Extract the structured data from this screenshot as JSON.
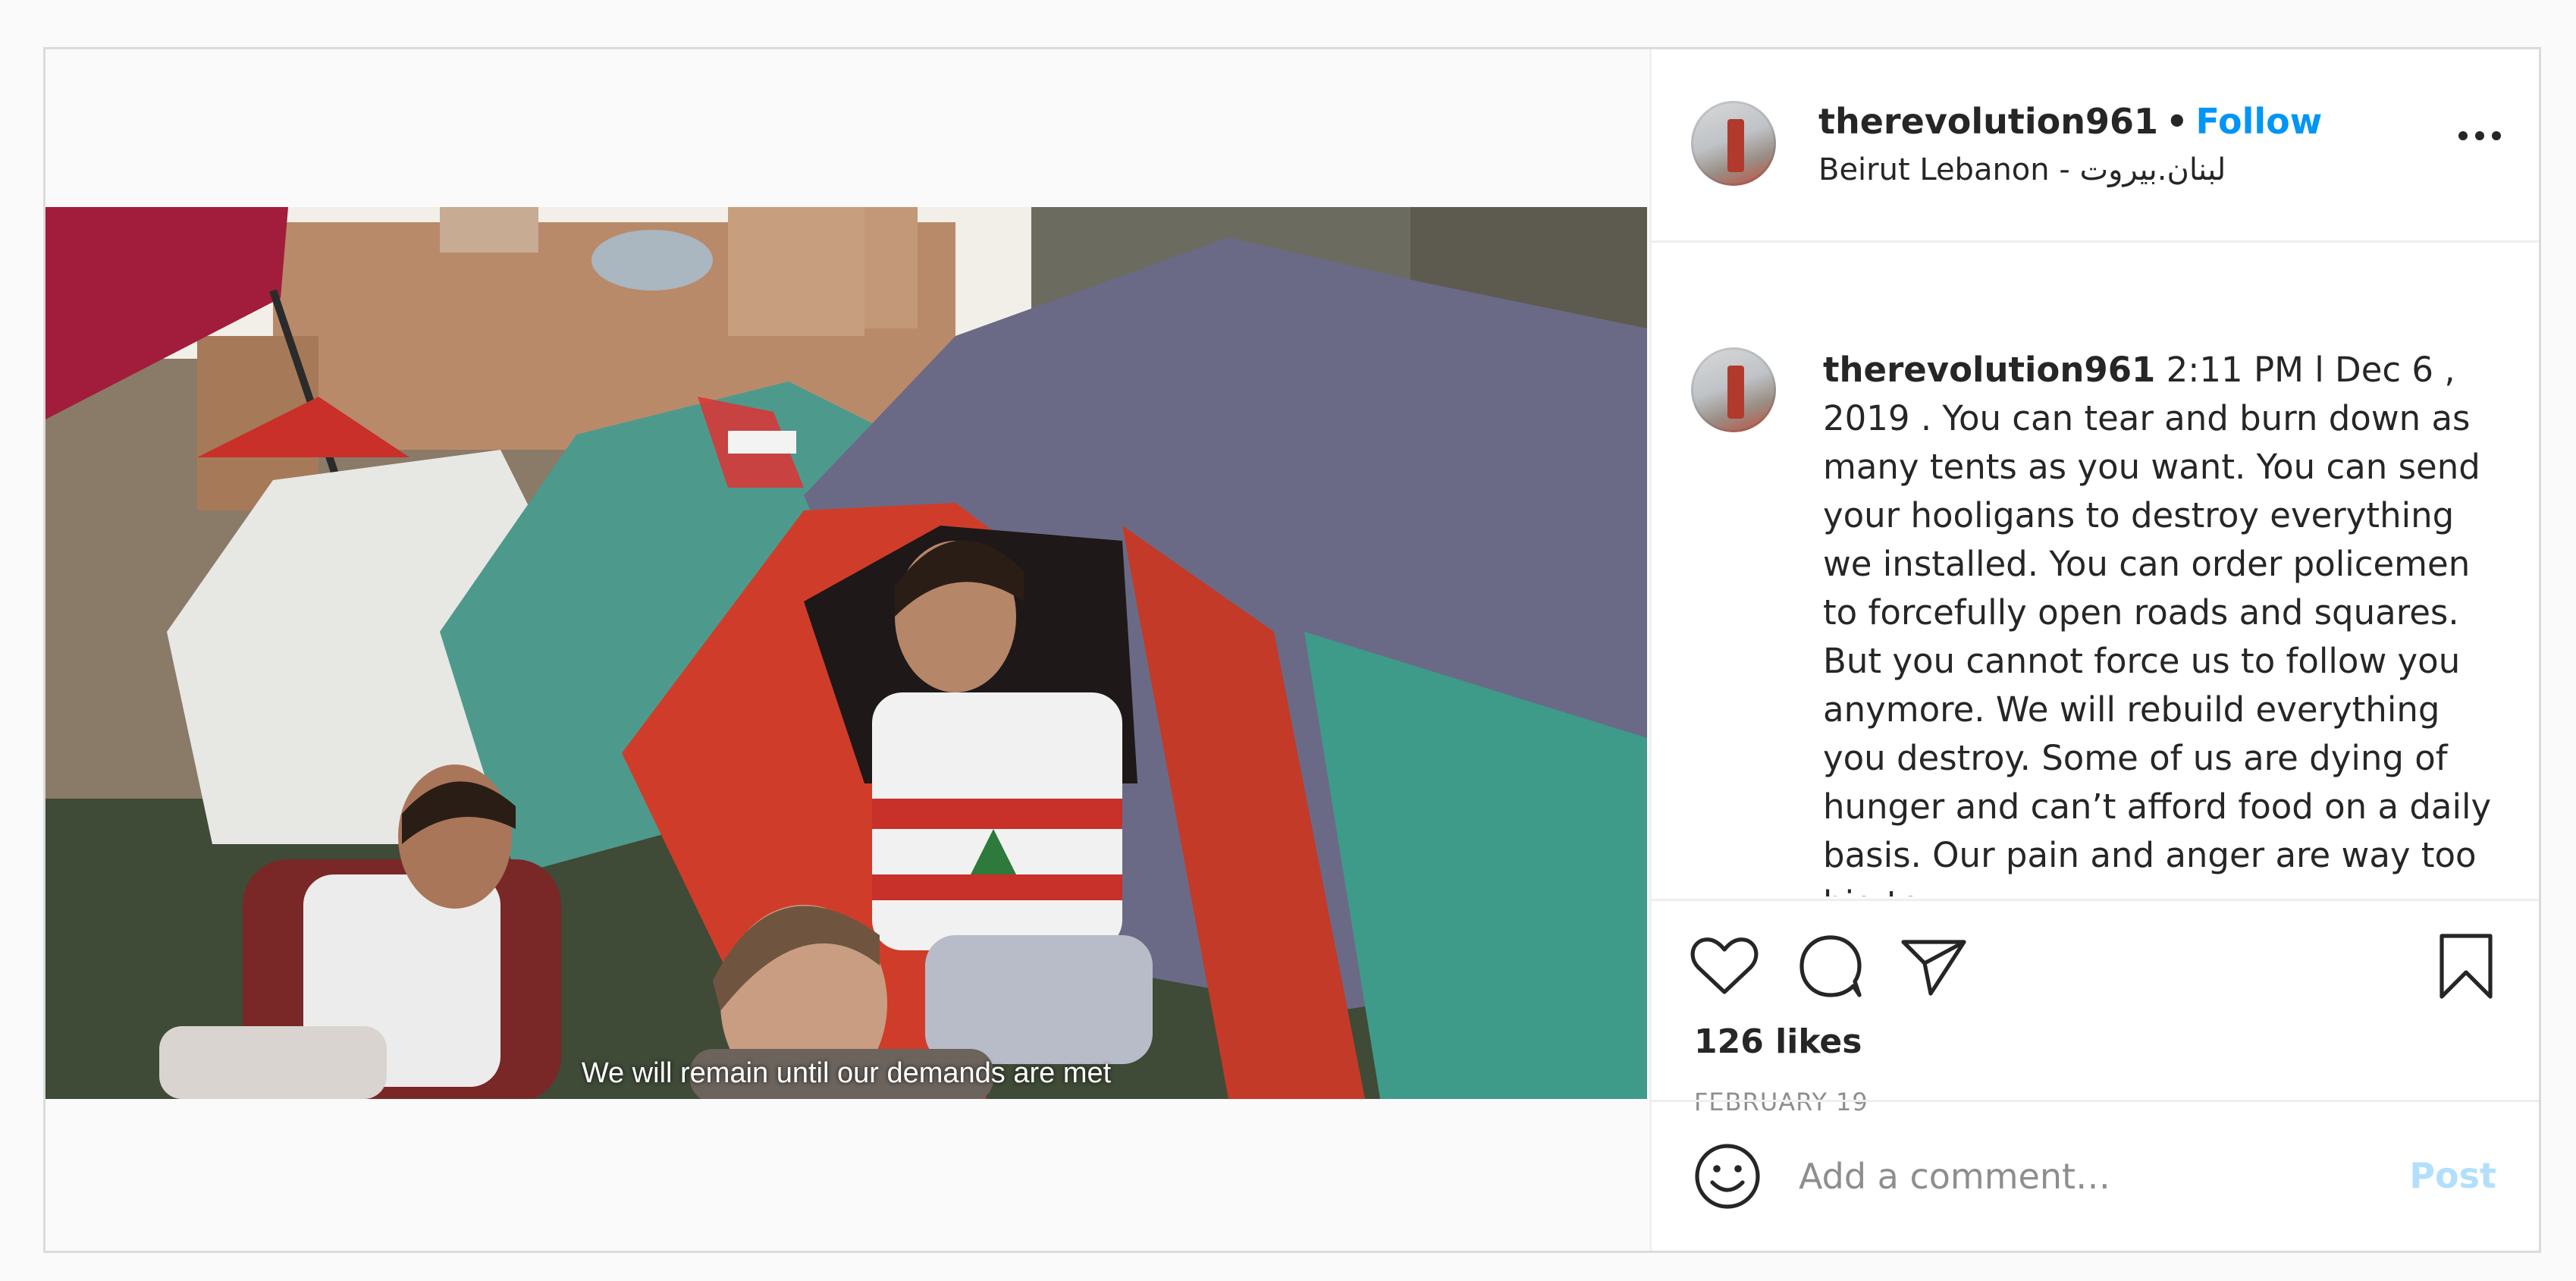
{
  "header": {
    "username": "therevolution961",
    "separator": "•",
    "follow_label": "Follow",
    "location": "Beirut Lebanon - لبنان.بيروت",
    "more_icon": "more-horizontal-icon"
  },
  "media": {
    "subtitle": "We will remain until our demands are met"
  },
  "caption": {
    "username": "therevolution961",
    "text": " 2:11 PM l Dec 6 , 2019 . You can tear and burn down as many tents as you want. You can send your hooligans to destroy everything we installed. You can order policemen to forcefully open roads and squares. But you cannot force us to follow you anymore. We will rebuild everything you destroy. Some of us are dying of hunger and can’t afford food on a daily basis. Our pain and anger are way too big to"
  },
  "actions": {
    "icons": [
      "heart-icon",
      "comment-icon",
      "share-icon",
      "bookmark-icon"
    ],
    "likes": "126 likes",
    "date": "FEBRUARY 19"
  },
  "comment_box": {
    "placeholder": "Add a comment…",
    "post_label": "Post",
    "emoji_icon": "emoji-icon"
  },
  "colors": {
    "follow": "#0095f6",
    "post_disabled": "#b2dffc",
    "muted": "#8e8e8e",
    "border": "#dbdbdb"
  }
}
